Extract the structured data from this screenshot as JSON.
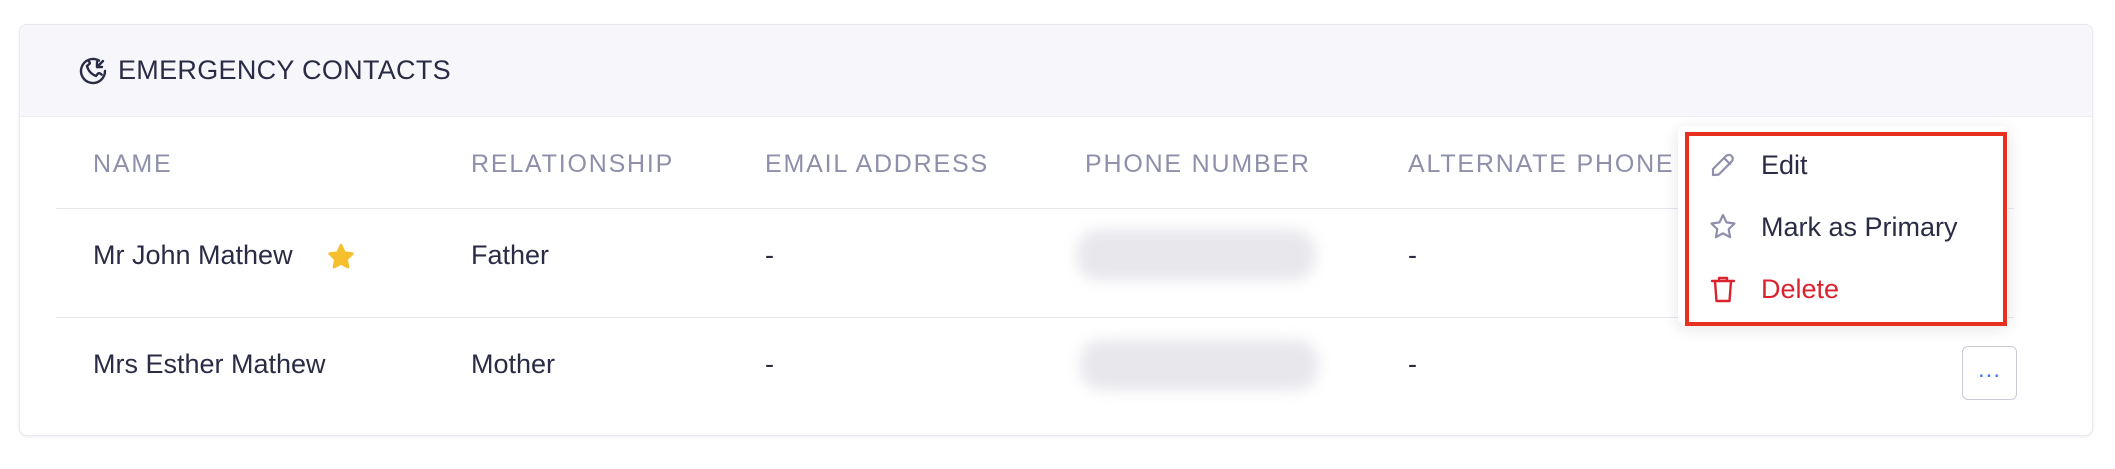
{
  "section": {
    "title": "EMERGENCY CONTACTS",
    "icon": "phone-incoming-icon"
  },
  "table": {
    "columns": [
      "NAME",
      "RELATIONSHIP",
      "EMAIL ADDRESS",
      "PHONE NUMBER",
      "ALTERNATE PHONE"
    ],
    "rows": [
      {
        "name": "Mr John Mathew",
        "relationship": "Father",
        "email": "-",
        "phone": "",
        "alternate_phone": "-",
        "primary": true
      },
      {
        "name": "Mrs Esther Mathew",
        "relationship": "Mother",
        "email": "-",
        "phone": "",
        "alternate_phone": "-",
        "primary": false
      }
    ]
  },
  "row_actions": {
    "more_label": "...",
    "menu": [
      {
        "label": "Edit",
        "icon": "pencil-icon"
      },
      {
        "label": "Mark as Primary",
        "icon": "star-outline-icon"
      },
      {
        "label": "Delete",
        "icon": "trash-icon",
        "danger": true
      }
    ]
  },
  "colors": {
    "primary_star": "#f5bf2e",
    "danger": "#d9232f",
    "highlight_box": "#e8301f",
    "header_text": "#8e90ab",
    "accent": "#3d7be6"
  }
}
